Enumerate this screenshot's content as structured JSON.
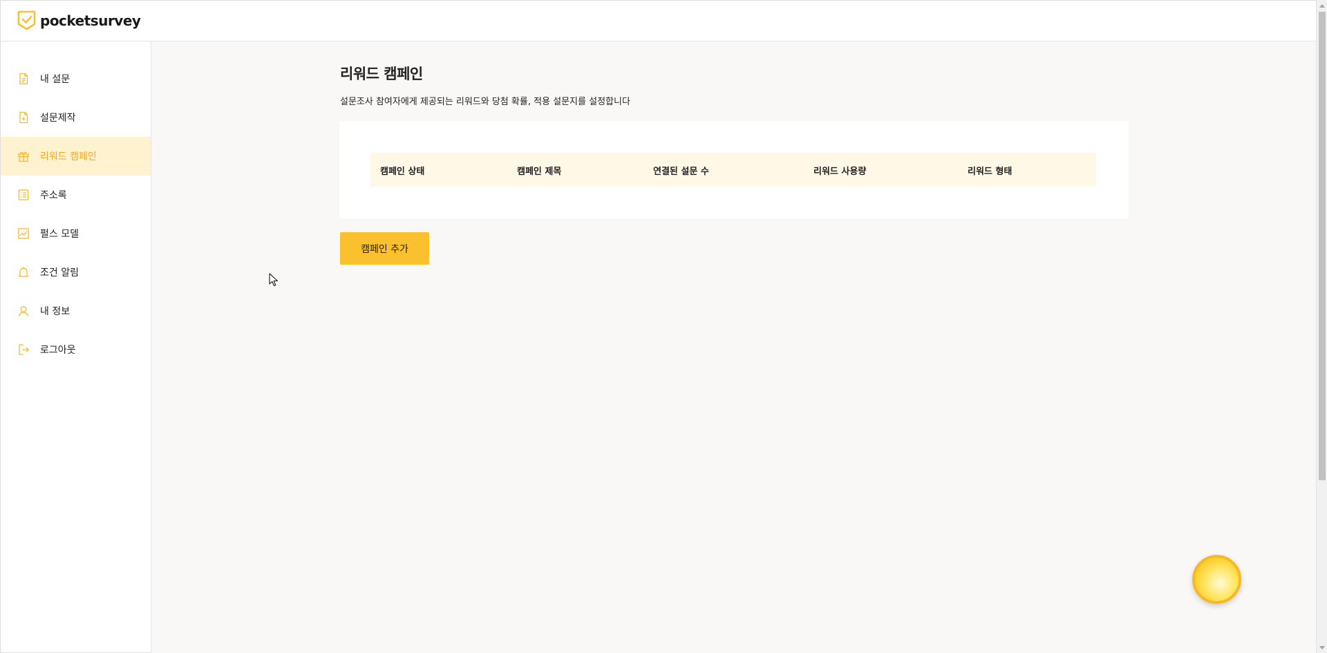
{
  "app": {
    "logo_text": "pocketsurvey",
    "brand_color": "#fbc02d"
  },
  "sidebar": {
    "items": [
      {
        "label": "내 설문",
        "icon": "document-icon"
      },
      {
        "label": "설문제작",
        "icon": "document-plus-icon"
      },
      {
        "label": "리워드 캠페인",
        "icon": "gift-icon",
        "active": true
      },
      {
        "label": "주소록",
        "icon": "list-icon"
      },
      {
        "label": "펄스 모델",
        "icon": "pulse-chart-icon"
      },
      {
        "label": "조건 알림",
        "icon": "bell-icon"
      },
      {
        "label": "내 정보",
        "icon": "user-icon"
      },
      {
        "label": "로그아웃",
        "icon": "logout-icon"
      }
    ]
  },
  "main": {
    "title": "리워드 캠페인",
    "description": "설문조사 참여자에게 제공되는 리워드와 당첨 확률, 적용 설문지를 설정합니다",
    "table": {
      "columns": [
        "캠페인 상태",
        "캠페인 제목",
        "연결된 설문 수",
        "리워드 사용량",
        "리워드 형태"
      ],
      "rows": []
    },
    "add_button_label": "캠페인 추가"
  },
  "colors": {
    "active_bg": "#fff3cf",
    "active_text": "#f5a623",
    "table_header_bg": "#fff8e7",
    "main_bg": "#faf8f6"
  }
}
